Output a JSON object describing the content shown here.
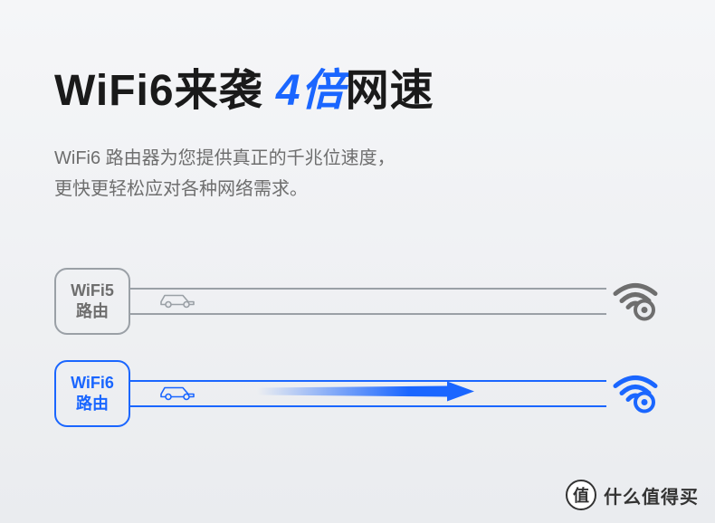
{
  "title": {
    "prefix": "WiFi6来袭 ",
    "accent": "4倍",
    "suffix": "网速"
  },
  "subtitle_line1": "WiFi6 路由器为您提供真正的千兆位速度，",
  "subtitle_line2": "更快更轻松应对各种网络需求。",
  "diagram": {
    "wifi5": {
      "name": "WiFi5",
      "sub": "路由",
      "color": "#9aa0a6"
    },
    "wifi6": {
      "name": "WiFi6",
      "sub": "路由",
      "color": "#1a66ff"
    }
  },
  "watermark": {
    "icon": "值",
    "text": "什么值得买"
  }
}
